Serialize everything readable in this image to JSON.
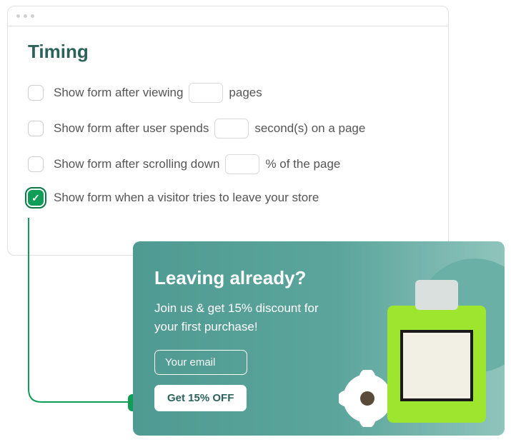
{
  "panel": {
    "heading": "Timing",
    "options": [
      {
        "pre": "Show form after viewing",
        "post": "pages",
        "checked": false
      },
      {
        "pre": "Show form after user spends",
        "post": "second(s) on a page",
        "checked": false
      },
      {
        "pre": "Show form after scrolling down",
        "post": "% of the page",
        "checked": false
      },
      {
        "full": "Show form when a visitor tries to leave your store",
        "checked": true
      }
    ]
  },
  "popup": {
    "title": "Leaving already?",
    "subtitle": "Join us & get 15% discount for your first purchase!",
    "email_placeholder": "Your email",
    "cta": "Get 15% OFF"
  }
}
